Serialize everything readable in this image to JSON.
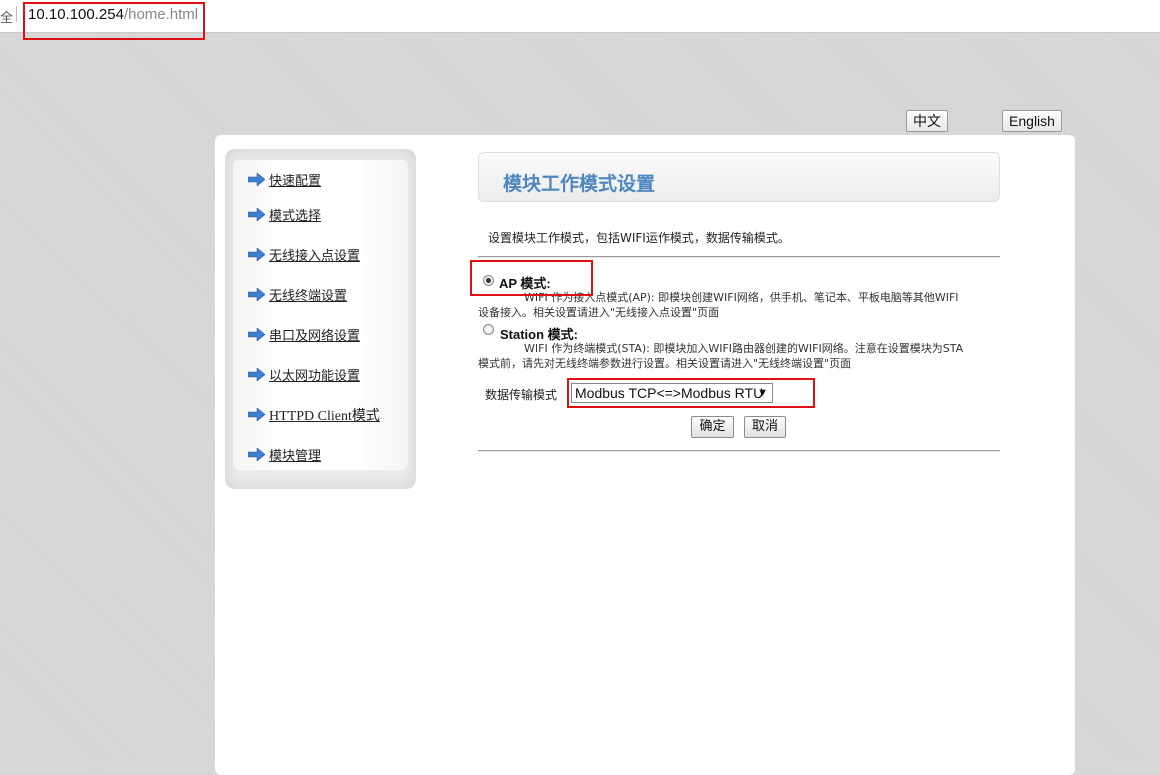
{
  "browser": {
    "address_prefix": "全",
    "url_host": "10.10.100.254",
    "url_path": "/home.html"
  },
  "lang": {
    "zh": "中文",
    "en": "English"
  },
  "sidebar": {
    "items": [
      {
        "label": "快速配置"
      },
      {
        "label": "模式选择"
      },
      {
        "label": "无线接入点设置"
      },
      {
        "label": "无线终端设置"
      },
      {
        "label": "串口及网络设置"
      },
      {
        "label": "以太网功能设置"
      },
      {
        "label": "HTTPD Client模式"
      },
      {
        "label": "模块管理"
      }
    ],
    "arrow_color": "#3f7fcf"
  },
  "content": {
    "title": "模块工作模式设置",
    "description": "设置模块工作模式，包括WIFI运作模式，数据传输模式。",
    "ap": {
      "label": "AP 模式:",
      "selected": true,
      "desc_line1": "WIFI 作为接入点模式(AP): 即模块创建WIFI网络，供手机、笔记本、平板电脑等其他WIFI",
      "desc_line2": "设备接入。相关设置请进入\"无线接入点设置\"页面"
    },
    "station": {
      "label": "Station 模式:",
      "selected": false,
      "desc_line1": "WIFI 作为终端模式(STA): 即模块加入WIFI路由器创建的WIFI网络。注意在设置模块为STA",
      "desc_line2": "模式前，请先对无线终端参数进行设置。相关设置请进入\"无线终端设置\"页面"
    },
    "transfer_label": "数据传输模式",
    "transfer_value": "Modbus TCP<=>Modbus RTU",
    "ok_label": "确定",
    "cancel_label": "取消"
  },
  "colors": {
    "title": "#4e86bf",
    "highlight": "#e01010"
  }
}
